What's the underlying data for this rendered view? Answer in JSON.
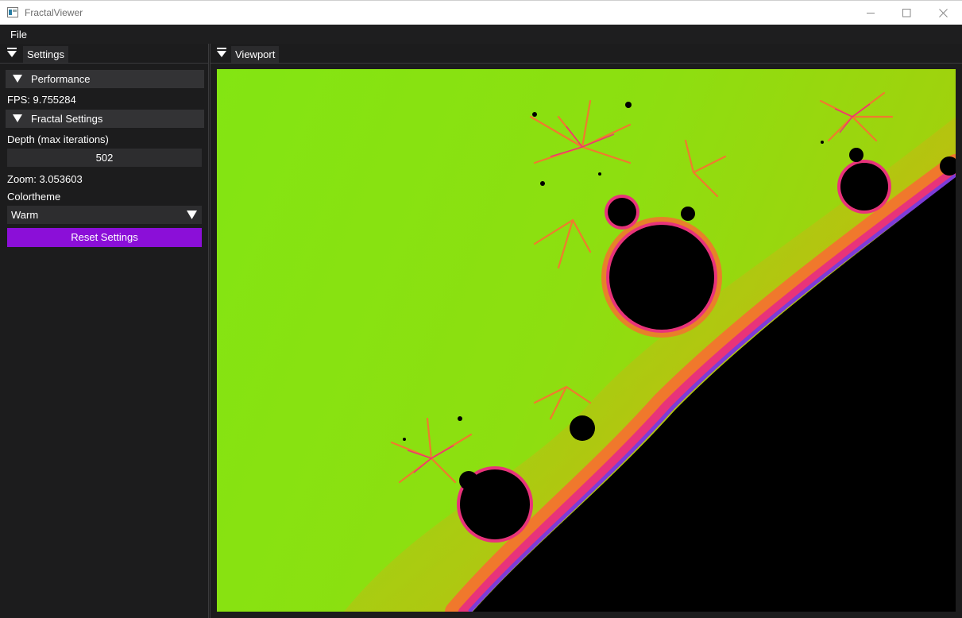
{
  "window": {
    "title": "FractalViewer"
  },
  "menubar": {
    "file_label": "File"
  },
  "settings_panel": {
    "tab_label": "Settings",
    "performance": {
      "header": "Performance",
      "fps_text": "FPS: 9.755284"
    },
    "fractal": {
      "header": "Fractal Settings",
      "depth_label": "Depth (max iterations)",
      "depth_value": "502",
      "zoom_text": "Zoom: 3.053603",
      "colortheme_label": "Colortheme",
      "colortheme_value": "Warm",
      "reset_label": "Reset Settings"
    }
  },
  "viewport_panel": {
    "tab_label": "Viewport"
  },
  "colors": {
    "accent": "#8b0fd8",
    "fractal_fill": "#85e612",
    "fractal_interior": "#000000",
    "fractal_edge_warm": "#f0782c",
    "fractal_edge_pink": "#e8337a",
    "fractal_edge_purple": "#7c3cd8"
  },
  "icons": {
    "app": "app-icon",
    "minimize": "minimize-icon",
    "maximize": "maximize-icon",
    "close": "close-icon",
    "collapse": "collapse-triangle-icon",
    "dropdown": "dropdown-arrow-icon"
  }
}
